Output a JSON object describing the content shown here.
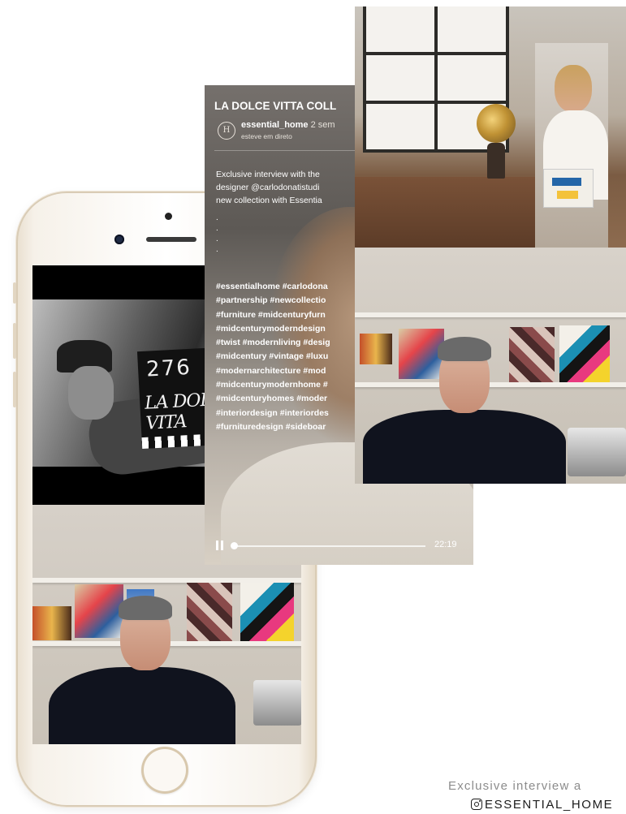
{
  "story": {
    "title": "LA DOLCE VITTA COLL",
    "avatar_letter": "H",
    "username": "essential_home",
    "time": "2 sem",
    "subtitle": "esteve em direto",
    "caption_lines": [
      "Exclusive interview with the",
      "designer @carlodonatistudi",
      "new collection with Essentia"
    ],
    "dots": [
      ".",
      ".",
      ".",
      "."
    ],
    "hashtag_lines": [
      "#essentialhome #carlodona",
      "#partnership #newcollectio",
      "#furniture #midcenturyfurn",
      "#midcenturymoderndesign",
      "#twist #modernliving #desig",
      "#midcentury #vintage #luxu",
      "#modernarchitecture #mod",
      "#midcenturymodernhome #",
      "#midcenturyhomes #moder",
      "#interiordesign #interiordes",
      "#furnituredesign #sideboar"
    ],
    "duration": "22:19",
    "progress": 0.0
  },
  "phone_video": {
    "clapper_number": "276",
    "clapper_title": "LA DOLCE VITA"
  },
  "footer": {
    "line": "Exclusive interview a",
    "handle": "ESSENTIAL_HOME"
  }
}
